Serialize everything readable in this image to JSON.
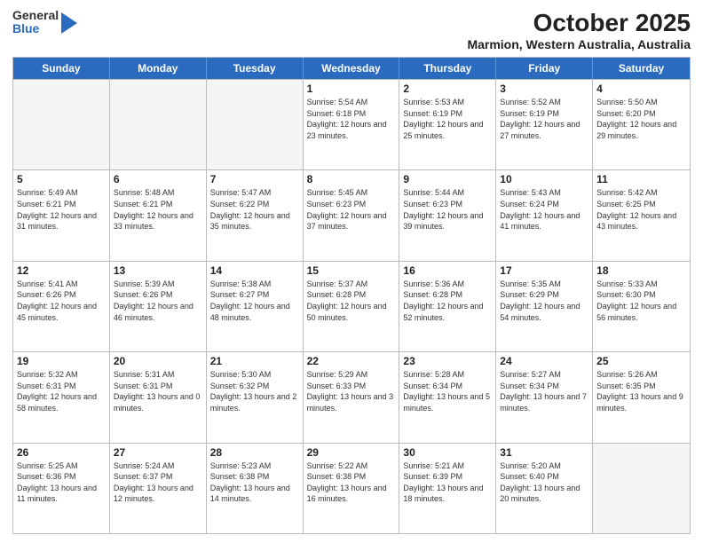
{
  "header": {
    "logo_general": "General",
    "logo_blue": "Blue",
    "title": "October 2025",
    "subtitle": "Marmion, Western Australia, Australia"
  },
  "weekdays": [
    "Sunday",
    "Monday",
    "Tuesday",
    "Wednesday",
    "Thursday",
    "Friday",
    "Saturday"
  ],
  "weeks": [
    [
      {
        "day": "",
        "sunrise": "",
        "sunset": "",
        "daylight": "",
        "empty": true
      },
      {
        "day": "",
        "sunrise": "",
        "sunset": "",
        "daylight": "",
        "empty": true
      },
      {
        "day": "",
        "sunrise": "",
        "sunset": "",
        "daylight": "",
        "empty": true
      },
      {
        "day": "1",
        "sunrise": "Sunrise: 5:54 AM",
        "sunset": "Sunset: 6:18 PM",
        "daylight": "Daylight: 12 hours and 23 minutes."
      },
      {
        "day": "2",
        "sunrise": "Sunrise: 5:53 AM",
        "sunset": "Sunset: 6:19 PM",
        "daylight": "Daylight: 12 hours and 25 minutes."
      },
      {
        "day": "3",
        "sunrise": "Sunrise: 5:52 AM",
        "sunset": "Sunset: 6:19 PM",
        "daylight": "Daylight: 12 hours and 27 minutes."
      },
      {
        "day": "4",
        "sunrise": "Sunrise: 5:50 AM",
        "sunset": "Sunset: 6:20 PM",
        "daylight": "Daylight: 12 hours and 29 minutes."
      }
    ],
    [
      {
        "day": "5",
        "sunrise": "Sunrise: 5:49 AM",
        "sunset": "Sunset: 6:21 PM",
        "daylight": "Daylight: 12 hours and 31 minutes."
      },
      {
        "day": "6",
        "sunrise": "Sunrise: 5:48 AM",
        "sunset": "Sunset: 6:21 PM",
        "daylight": "Daylight: 12 hours and 33 minutes."
      },
      {
        "day": "7",
        "sunrise": "Sunrise: 5:47 AM",
        "sunset": "Sunset: 6:22 PM",
        "daylight": "Daylight: 12 hours and 35 minutes."
      },
      {
        "day": "8",
        "sunrise": "Sunrise: 5:45 AM",
        "sunset": "Sunset: 6:23 PM",
        "daylight": "Daylight: 12 hours and 37 minutes."
      },
      {
        "day": "9",
        "sunrise": "Sunrise: 5:44 AM",
        "sunset": "Sunset: 6:23 PM",
        "daylight": "Daylight: 12 hours and 39 minutes."
      },
      {
        "day": "10",
        "sunrise": "Sunrise: 5:43 AM",
        "sunset": "Sunset: 6:24 PM",
        "daylight": "Daylight: 12 hours and 41 minutes."
      },
      {
        "day": "11",
        "sunrise": "Sunrise: 5:42 AM",
        "sunset": "Sunset: 6:25 PM",
        "daylight": "Daylight: 12 hours and 43 minutes."
      }
    ],
    [
      {
        "day": "12",
        "sunrise": "Sunrise: 5:41 AM",
        "sunset": "Sunset: 6:26 PM",
        "daylight": "Daylight: 12 hours and 45 minutes."
      },
      {
        "day": "13",
        "sunrise": "Sunrise: 5:39 AM",
        "sunset": "Sunset: 6:26 PM",
        "daylight": "Daylight: 12 hours and 46 minutes."
      },
      {
        "day": "14",
        "sunrise": "Sunrise: 5:38 AM",
        "sunset": "Sunset: 6:27 PM",
        "daylight": "Daylight: 12 hours and 48 minutes."
      },
      {
        "day": "15",
        "sunrise": "Sunrise: 5:37 AM",
        "sunset": "Sunset: 6:28 PM",
        "daylight": "Daylight: 12 hours and 50 minutes."
      },
      {
        "day": "16",
        "sunrise": "Sunrise: 5:36 AM",
        "sunset": "Sunset: 6:28 PM",
        "daylight": "Daylight: 12 hours and 52 minutes."
      },
      {
        "day": "17",
        "sunrise": "Sunrise: 5:35 AM",
        "sunset": "Sunset: 6:29 PM",
        "daylight": "Daylight: 12 hours and 54 minutes."
      },
      {
        "day": "18",
        "sunrise": "Sunrise: 5:33 AM",
        "sunset": "Sunset: 6:30 PM",
        "daylight": "Daylight: 12 hours and 56 minutes."
      }
    ],
    [
      {
        "day": "19",
        "sunrise": "Sunrise: 5:32 AM",
        "sunset": "Sunset: 6:31 PM",
        "daylight": "Daylight: 12 hours and 58 minutes."
      },
      {
        "day": "20",
        "sunrise": "Sunrise: 5:31 AM",
        "sunset": "Sunset: 6:31 PM",
        "daylight": "Daylight: 13 hours and 0 minutes."
      },
      {
        "day": "21",
        "sunrise": "Sunrise: 5:30 AM",
        "sunset": "Sunset: 6:32 PM",
        "daylight": "Daylight: 13 hours and 2 minutes."
      },
      {
        "day": "22",
        "sunrise": "Sunrise: 5:29 AM",
        "sunset": "Sunset: 6:33 PM",
        "daylight": "Daylight: 13 hours and 3 minutes."
      },
      {
        "day": "23",
        "sunrise": "Sunrise: 5:28 AM",
        "sunset": "Sunset: 6:34 PM",
        "daylight": "Daylight: 13 hours and 5 minutes."
      },
      {
        "day": "24",
        "sunrise": "Sunrise: 5:27 AM",
        "sunset": "Sunset: 6:34 PM",
        "daylight": "Daylight: 13 hours and 7 minutes."
      },
      {
        "day": "25",
        "sunrise": "Sunrise: 5:26 AM",
        "sunset": "Sunset: 6:35 PM",
        "daylight": "Daylight: 13 hours and 9 minutes."
      }
    ],
    [
      {
        "day": "26",
        "sunrise": "Sunrise: 5:25 AM",
        "sunset": "Sunset: 6:36 PM",
        "daylight": "Daylight: 13 hours and 11 minutes."
      },
      {
        "day": "27",
        "sunrise": "Sunrise: 5:24 AM",
        "sunset": "Sunset: 6:37 PM",
        "daylight": "Daylight: 13 hours and 12 minutes."
      },
      {
        "day": "28",
        "sunrise": "Sunrise: 5:23 AM",
        "sunset": "Sunset: 6:38 PM",
        "daylight": "Daylight: 13 hours and 14 minutes."
      },
      {
        "day": "29",
        "sunrise": "Sunrise: 5:22 AM",
        "sunset": "Sunset: 6:38 PM",
        "daylight": "Daylight: 13 hours and 16 minutes."
      },
      {
        "day": "30",
        "sunrise": "Sunrise: 5:21 AM",
        "sunset": "Sunset: 6:39 PM",
        "daylight": "Daylight: 13 hours and 18 minutes."
      },
      {
        "day": "31",
        "sunrise": "Sunrise: 5:20 AM",
        "sunset": "Sunset: 6:40 PM",
        "daylight": "Daylight: 13 hours and 20 minutes."
      },
      {
        "day": "",
        "sunrise": "",
        "sunset": "",
        "daylight": "",
        "empty": true
      }
    ]
  ]
}
